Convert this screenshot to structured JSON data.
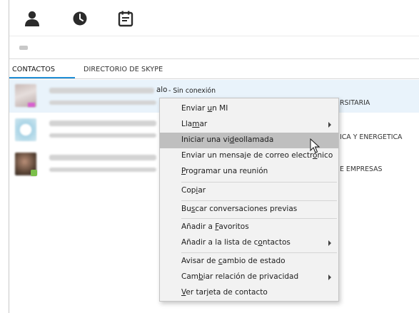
{
  "tabs": {
    "contacts": "CONTACTOS",
    "directory": "DIRECTORIO DE SKYPE"
  },
  "contacts": [
    {
      "name_suffix": "alo",
      "status": " - Sin conexión",
      "mood_suffix": "RSITARIA"
    },
    {
      "mood_suffix": "ICA Y ENERGETICA"
    },
    {
      "mood_suffix": "E EMPRESAS"
    }
  ],
  "context_menu": {
    "items": [
      {
        "pre": "Enviar ",
        "ul": "u",
        "post": "n MI"
      },
      {
        "pre": "Lla",
        "ul": "m",
        "post": "ar"
      },
      {
        "pre": "Iniciar una vi",
        "ul": "d",
        "post": "eollamada"
      },
      {
        "pre": "Enviar un mensaje de correo electr",
        "ul": "ó",
        "post": "nico"
      },
      {
        "pre": "",
        "ul": "P",
        "post": "rogramar una reunión"
      },
      {
        "pre": "Cop",
        "ul": "i",
        "post": "ar"
      },
      {
        "pre": "Bu",
        "ul": "s",
        "post": "car conversaciones previas"
      },
      {
        "pre": "Añadir a ",
        "ul": "F",
        "post": "avoritos"
      },
      {
        "pre": "Añadir a la lista de c",
        "ul": "o",
        "post": "ntactos"
      },
      {
        "pre": "Avisar de ",
        "ul": "c",
        "post": "ambio de estado"
      },
      {
        "pre": "Cam",
        "ul": "b",
        "post": "iar relación de privacidad"
      },
      {
        "pre": "",
        "ul": "V",
        "post": "er tarjeta de contacto"
      }
    ]
  },
  "icons": {
    "contacts_tab": "person-icon",
    "recent_tab": "clock-icon",
    "meetings_tab": "calendar-icon",
    "cursor": "mouse-pointer-icon"
  },
  "colors": {
    "accent": "#1f8ed6",
    "selected_row": "#e9f3fb",
    "menu_bg": "#f2f2f2",
    "menu_highlight": "#bfbfbf",
    "icon_dark": "#2b2b2b"
  }
}
